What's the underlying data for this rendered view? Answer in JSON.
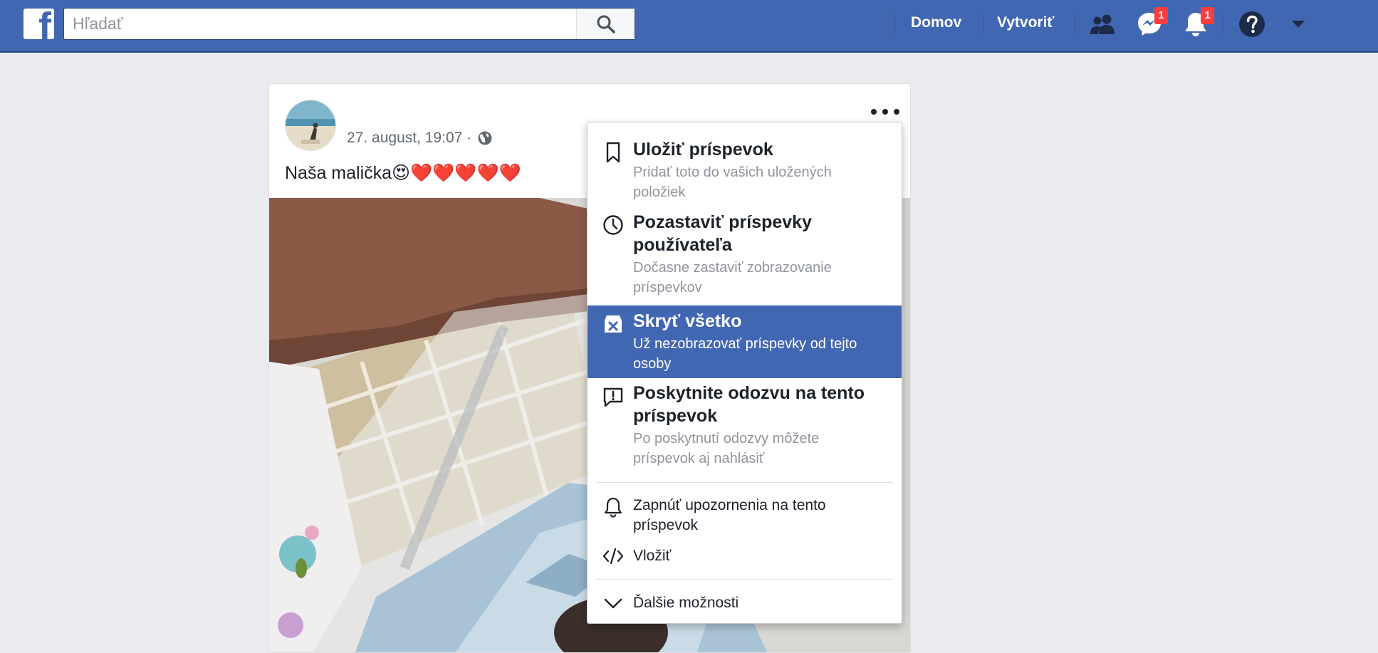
{
  "topbar": {
    "logo": "f",
    "search": {
      "placeholder": "Hľadať",
      "value": ""
    },
    "nav": {
      "home": "Domov",
      "create": "Vytvoriť"
    },
    "icons": [
      "friends-icon",
      "messenger-icon",
      "notifications-icon",
      "help-icon",
      "account-menu-icon"
    ],
    "messenger_badge": "1",
    "notifications_badge": "1"
  },
  "post": {
    "timestamp": "27. august, 19:07 ·",
    "privacy_icon": "globe-icon",
    "text": "Naša malička😍❤️❤️❤️❤️❤️",
    "options_icon": "ellipsis-icon"
  },
  "menu": {
    "items": [
      {
        "icon": "bookmark-icon",
        "title": "Uložiť príspevok",
        "subtitle": "Pridať toto do vašich uložených položiek"
      },
      {
        "icon": "clock-icon",
        "title": "Pozastaviť príspevky používateľa",
        "subtitle": "Dočasne zastaviť zobrazovanie príspevkov"
      },
      {
        "icon": "hide-all-icon",
        "title": "Skryť všetko",
        "subtitle": "Už nezobrazovať príspevky od tejto osoby"
      },
      {
        "icon": "feedback-icon",
        "title": "Poskytnite odozvu na tento príspevok",
        "subtitle": "Po poskytnutí odozvy môžete príspevok aj nahlásiť"
      }
    ],
    "notifications_label": "Zapnúť upozornenia na tento príspevok",
    "embed_label": "Vložiť",
    "more_label": "Ďalšie možnosti",
    "active_item": "Skryť všetko"
  },
  "colors": {
    "brand": "#4267b2",
    "background": "#e9ebee",
    "badge": "#fa3e3e"
  }
}
